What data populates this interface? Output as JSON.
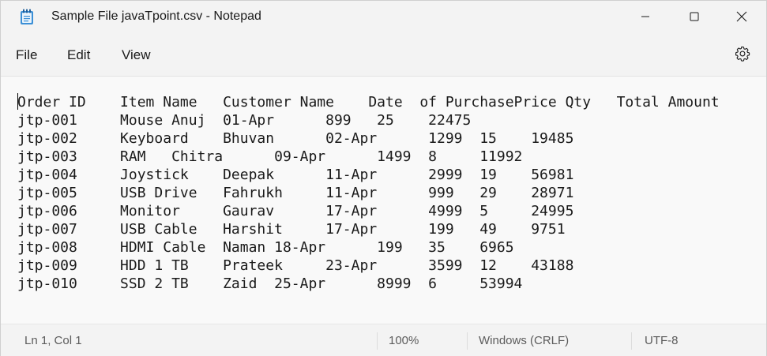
{
  "window": {
    "title": "Sample File javaTpoint.csv - Notepad"
  },
  "menu": {
    "file": "File",
    "edit": "Edit",
    "view": "View"
  },
  "icons": {
    "app": "notepad-icon",
    "minimize": "minimize-icon",
    "maximize": "maximize-icon",
    "close": "close-icon",
    "settings": "gear-icon"
  },
  "editor": {
    "lines": [
      "Order ID    Item Name   Customer Name    Date  of PurchasePrice Qty   Total Amount",
      "jtp-001     Mouse Anuj  01-Apr      899   25    22475",
      "jtp-002     Keyboard    Bhuvan      02-Apr      1299  15    19485",
      "jtp-003     RAM   Chitra      09-Apr      1499  8     11992",
      "jtp-004     Joystick    Deepak      11-Apr      2999  19    56981",
      "jtp-005     USB Drive   Fahrukh     11-Apr      999   29    28971",
      "jtp-006     Monitor     Gaurav      17-Apr      4999  5     24995",
      "jtp-007     USB Cable   Harshit     17-Apr      199   49    9751",
      "jtp-008     HDMI Cable  Naman 18-Apr      199   35    6965",
      "jtp-009     HDD 1 TB    Prateek     23-Apr      3599  12    43188",
      "jtp-010     SSD 2 TB    Zaid  25-Apr      8999  6     53994"
    ]
  },
  "status": {
    "position": "Ln 1, Col 1",
    "zoom": "100%",
    "line_ending": "Windows (CRLF)",
    "encoding": "UTF-8"
  }
}
